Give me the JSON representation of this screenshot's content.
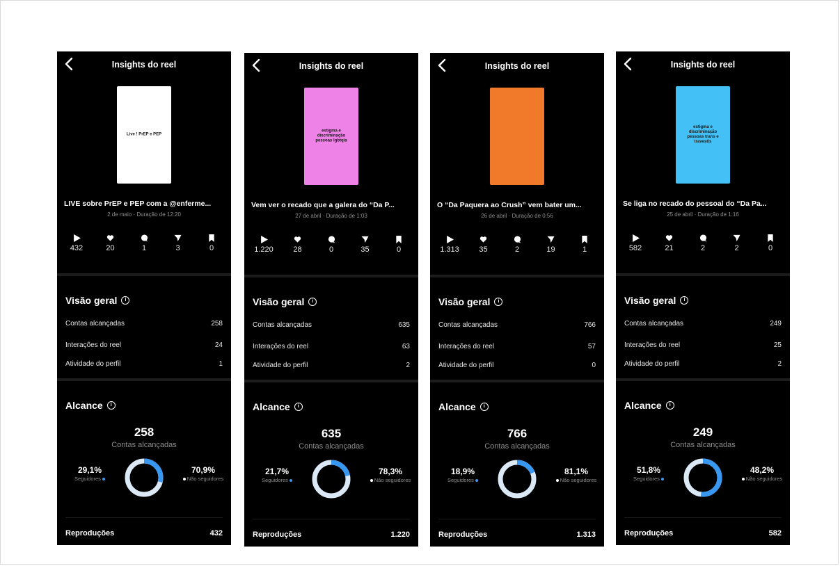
{
  "header_title": "Insights do reel",
  "overview_title": "Visão geral",
  "reach_title": "Alcance",
  "overview_labels": {
    "accounts": "Contas alcançadas",
    "interactions": "Interações do reel",
    "profile": "Atividade do perfil"
  },
  "reach_label": "Contas alcançadas",
  "followers_label": "Seguidores",
  "non_followers_label": "Não seguidores",
  "plays_label": "Reproduções",
  "colors": {
    "accent": "#3897f0",
    "ring_light": "#dbe9f7"
  },
  "reels": [
    {
      "thumb_text": "Live ! PrEP e PEP",
      "thumb_bg": "#ffffff",
      "caption": "LIVE sobre PrEP e PEP com a @enferme...",
      "meta": "2 de maio · Duração de 12:20",
      "stats": {
        "plays": "432",
        "likes": "20",
        "comments": "1",
        "shares": "3",
        "saves": "0"
      },
      "overview": {
        "accounts": "258",
        "interactions": "24",
        "profile": "1"
      },
      "reach": {
        "total": "258",
        "followers_pct": "29,1%",
        "non_followers_pct": "70,9%",
        "followers_fraction": 0.291
      },
      "plays_total": "432"
    },
    {
      "thumb_text": "estigma e discriminação pessoas lgbtqia",
      "thumb_bg": "#ee82e6",
      "caption": "Vem ver o recado que a galera do “Da P...",
      "meta": "27 de abril · Duração de 1:03",
      "stats": {
        "plays": "1.220",
        "likes": "28",
        "comments": "0",
        "shares": "35",
        "saves": "0"
      },
      "overview": {
        "accounts": "635",
        "interactions": "63",
        "profile": "2"
      },
      "reach": {
        "total": "635",
        "followers_pct": "21,7%",
        "non_followers_pct": "78,3%",
        "followers_fraction": 0.217
      },
      "plays_total": "1.220"
    },
    {
      "thumb_text": "",
      "thumb_bg": "#f07a2a",
      "caption": "O “Da Paquera ao Crush” vem bater um...",
      "meta": "26 de abril · Duração de 0:56",
      "stats": {
        "plays": "1.313",
        "likes": "35",
        "comments": "2",
        "shares": "19",
        "saves": "1"
      },
      "overview": {
        "accounts": "766",
        "interactions": "57",
        "profile": "0"
      },
      "reach": {
        "total": "766",
        "followers_pct": "18,9%",
        "non_followers_pct": "81,1%",
        "followers_fraction": 0.189
      },
      "plays_total": "1.313"
    },
    {
      "thumb_text": "estigma e discriminação pessoas trans e travestis",
      "thumb_bg": "#43c0f5",
      "caption": "Se liga no recado do pessoal do “Da Pa...",
      "meta": "25 de abril · Duração de 1:16",
      "stats": {
        "plays": "582",
        "likes": "21",
        "comments": "2",
        "shares": "2",
        "saves": "0"
      },
      "overview": {
        "accounts": "249",
        "interactions": "25",
        "profile": "2"
      },
      "reach": {
        "total": "249",
        "followers_pct": "51,8%",
        "non_followers_pct": "48,2%",
        "followers_fraction": 0.518
      },
      "plays_total": "582"
    }
  ]
}
